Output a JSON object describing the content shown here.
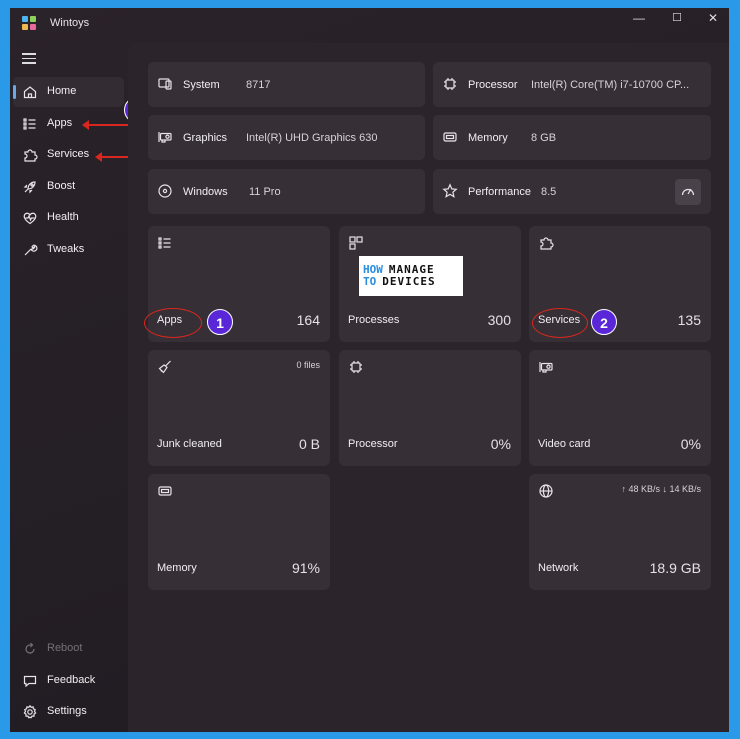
{
  "app": {
    "title": "Wintoys"
  },
  "window_controls": {
    "minimize": "—",
    "maximize": "☐",
    "close": "✕"
  },
  "sidebar": {
    "items": [
      {
        "label": "Home",
        "icon": "home-icon"
      },
      {
        "label": "Apps",
        "icon": "list-icon"
      },
      {
        "label": "Services",
        "icon": "puzzle-icon"
      },
      {
        "label": "Boost",
        "icon": "rocket-icon"
      },
      {
        "label": "Health",
        "icon": "heart-pulse-icon"
      },
      {
        "label": "Tweaks",
        "icon": "wrench-icon"
      }
    ],
    "bottom_items": [
      {
        "label": "Reboot",
        "icon": "reboot-icon"
      },
      {
        "label": "Feedback",
        "icon": "feedback-icon"
      },
      {
        "label": "Settings",
        "icon": "gear-icon"
      }
    ]
  },
  "info": {
    "system": {
      "label": "System",
      "value": "8717"
    },
    "processor": {
      "label": "Processor",
      "value": "Intel(R) Core(TM) i7-10700 CP..."
    },
    "graphics": {
      "label": "Graphics",
      "value": "Intel(R) UHD Graphics 630"
    },
    "memory": {
      "label": "Memory",
      "value": "8 GB"
    },
    "windows": {
      "label": "Windows",
      "value": "11 Pro"
    },
    "performance": {
      "label": "Performance",
      "value": "8.5"
    }
  },
  "tiles": {
    "apps": {
      "label": "Apps",
      "value": "164"
    },
    "processes": {
      "label": "Processes",
      "value": "300"
    },
    "services": {
      "label": "Services",
      "value": "135"
    },
    "junk": {
      "label": "Junk cleaned",
      "value": "0 B",
      "sub": "0 files"
    },
    "processor": {
      "label": "Processor",
      "value": "0%"
    },
    "videocard": {
      "label": "Video card",
      "value": "0%"
    },
    "memory": {
      "label": "Memory",
      "value": "91%"
    },
    "network": {
      "label": "Network",
      "value": "18.9 GB",
      "sub": "↑ 48 KB/s  ↓ 14 KB/s"
    }
  },
  "watermark": {
    "line1a": "HOW",
    "line1b": "MANAGE",
    "line2a": "TO",
    "line2b": "DEVICES"
  },
  "annotations": {
    "badge1": "1",
    "badge2": "2"
  },
  "colors": {
    "accent": "#6aa9e8",
    "annotation_red": "#d8271e",
    "badge_purple": "#5a27d8",
    "frame_blue": "#2a9ae8"
  }
}
